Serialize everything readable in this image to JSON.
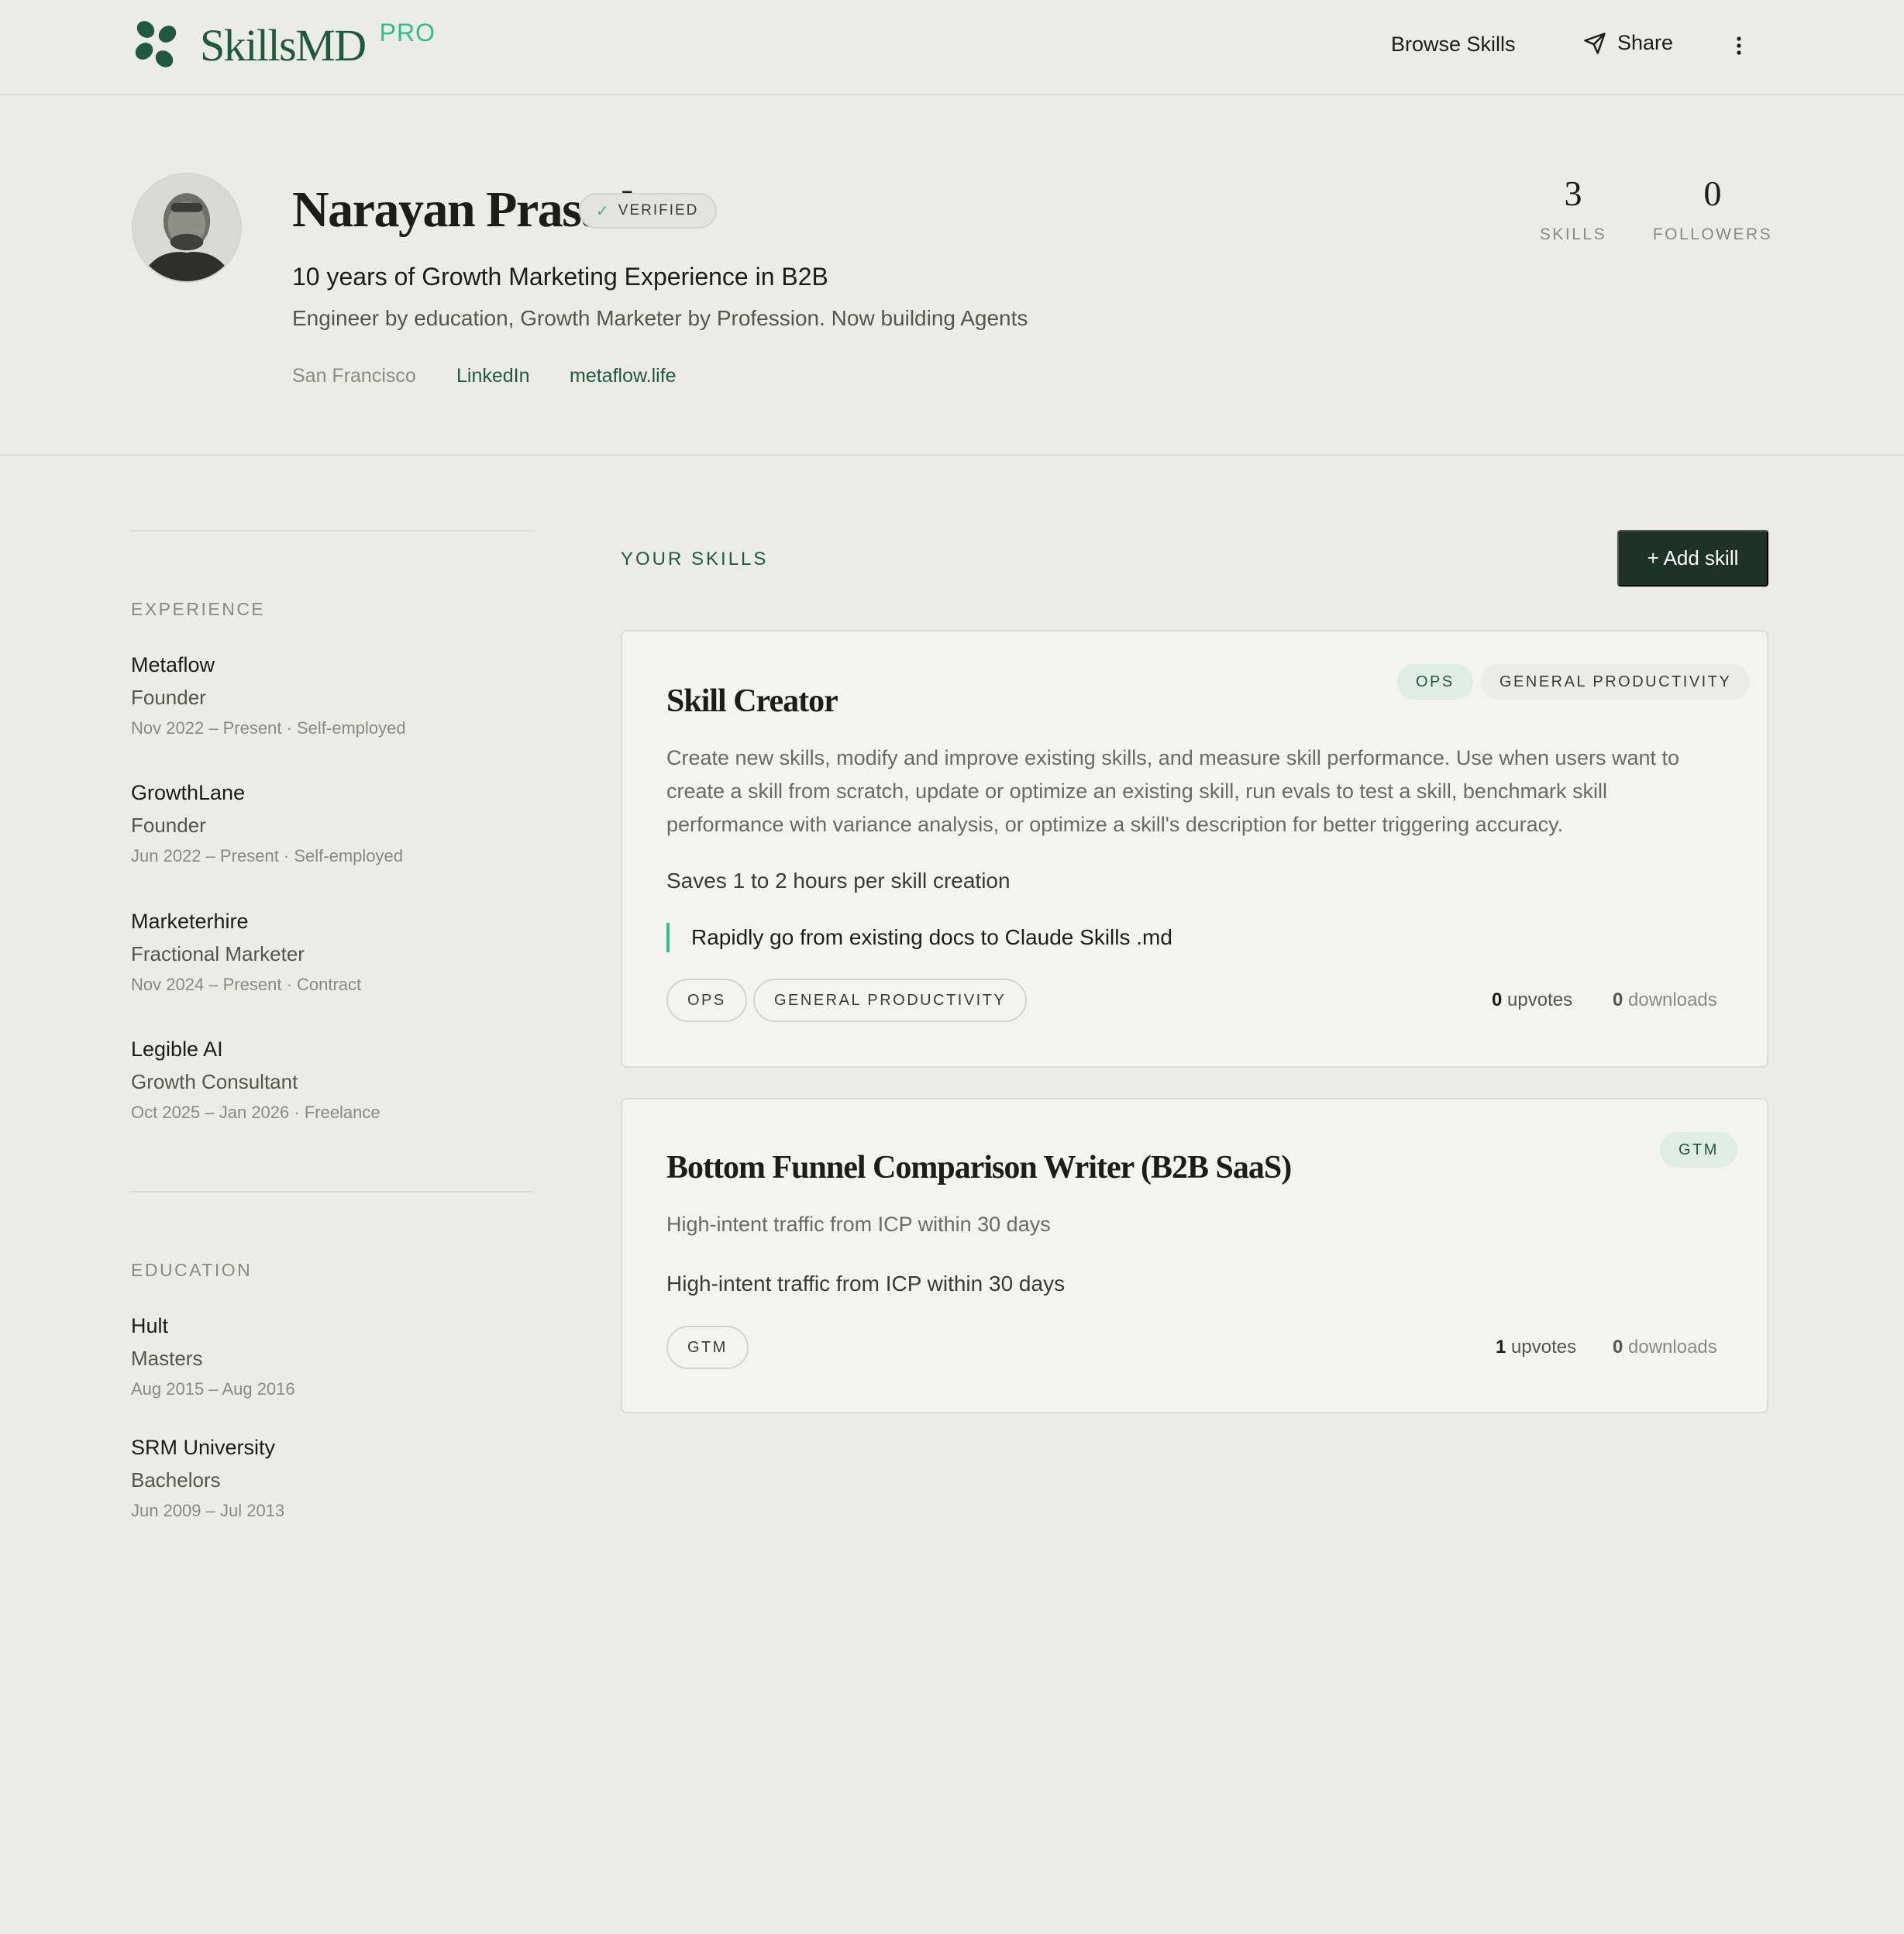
{
  "brand": {
    "name": "SkillsMD",
    "tier": "PRO",
    "logo_icon": "clover-logo-icon",
    "accent": "#2ec08a",
    "brand_green": "#1f5a40"
  },
  "nav": {
    "browse": "Browse Skills",
    "share": "Share",
    "share_icon": "send-icon",
    "more_icon": "vertical-dots-icon"
  },
  "profile": {
    "name": "Narayan Prasath",
    "verified": "VERIFIED",
    "headline": "10 years of Growth Marketing Experience in B2B",
    "bio": "Engineer by education, Growth Marketer by Profession. Now building Agents",
    "location": "San Francisco",
    "links": [
      "LinkedIn",
      "metaflow.life"
    ],
    "stats": [
      {
        "value": "3",
        "label": "SKILLS"
      },
      {
        "value": "0",
        "label": "FOLLOWERS"
      }
    ]
  },
  "experience": {
    "heading": "EXPERIENCE",
    "items": [
      {
        "org": "Metaflow",
        "role": "Founder",
        "dates": "Nov 2022 – Present · Self-employed"
      },
      {
        "org": "GrowthLane",
        "role": "Founder",
        "dates": "Jun 2022 – Present · Self-employed"
      },
      {
        "org": "Marketerhire",
        "role": "Fractional Marketer",
        "dates": "Nov 2024 – Present · Contract"
      },
      {
        "org": "Legible AI",
        "role": "Growth Consultant",
        "dates": "Oct 2025 – Jan 2026 · Freelance"
      }
    ]
  },
  "education": {
    "heading": "EDUCATION",
    "items": [
      {
        "org": "Hult",
        "role": "Masters",
        "dates": "Aug 2015 – Aug 2016"
      },
      {
        "org": "SRM University",
        "role": "Bachelors",
        "dates": "Jun 2009 – Jul 2013"
      }
    ]
  },
  "skills": {
    "heading": "YOUR SKILLS",
    "add_button": "+ Add skill",
    "items": [
      {
        "title": "Skill Creator",
        "tags": [
          "OPS",
          "GENERAL PRODUCTIVITY"
        ],
        "description": "Create new skills, modify and improve existing skills, and measure skill performance. Use when users want to create a skill from scratch, update or optimize an existing skill, run evals to test a skill, benchmark skill performance with variance analysis, or optimize a skill's description for better triggering accuracy.",
        "saves": "Saves 1 to 2 hours per skill creation",
        "quote": "Rapidly go from existing docs to Claude Skills .md",
        "upvotes": "0",
        "upvotes_label": "upvotes",
        "downloads": "0",
        "downloads_label": "downloads"
      },
      {
        "title": "Bottom Funnel Comparison Writer (B2B SaaS)",
        "tags": [
          "GTM"
        ],
        "description": "High-intent traffic from ICP within 30 days",
        "saves": "High-intent traffic from ICP within 30 days",
        "upvotes": "1",
        "upvotes_label": "upvotes",
        "downloads": "0",
        "downloads_label": "downloads"
      }
    ]
  }
}
